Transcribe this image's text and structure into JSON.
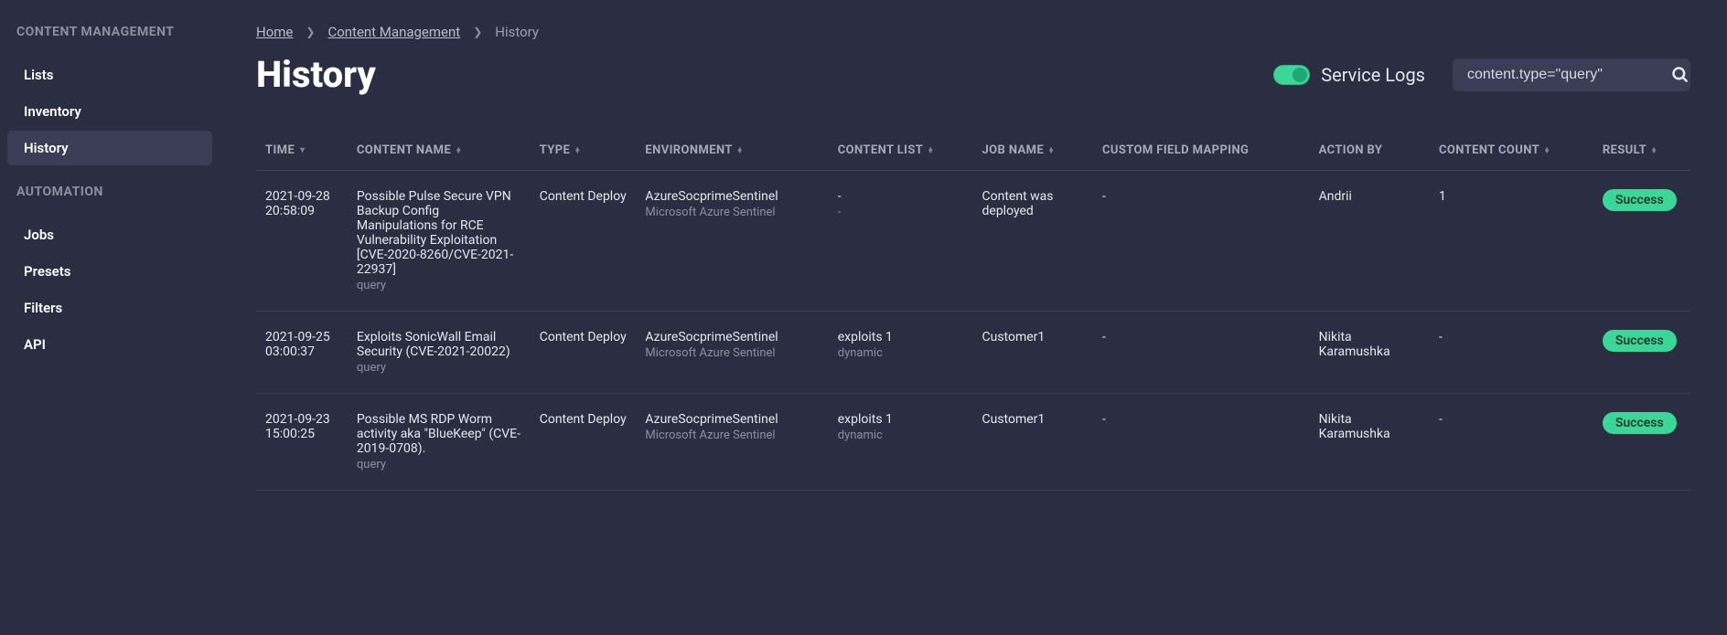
{
  "sidebar": {
    "section1_title": "CONTENT MANAGEMENT",
    "items1": [
      {
        "label": "Lists",
        "active": false
      },
      {
        "label": "Inventory",
        "active": false
      },
      {
        "label": "History",
        "active": true
      }
    ],
    "section2_title": "AUTOMATION",
    "items2": [
      {
        "label": "Jobs",
        "active": false
      },
      {
        "label": "Presets",
        "active": false
      },
      {
        "label": "Filters",
        "active": false
      },
      {
        "label": "API",
        "active": false
      }
    ]
  },
  "breadcrumb": {
    "items": [
      {
        "label": "Home",
        "link": true
      },
      {
        "label": "Content Management",
        "link": true
      },
      {
        "label": "History",
        "link": false
      }
    ]
  },
  "page": {
    "title": "History",
    "toggle_label": "Service Logs",
    "search_value": "content.type=\"query\""
  },
  "table": {
    "columns": [
      {
        "label": "TIME",
        "sort": "desc"
      },
      {
        "label": "CONTENT NAME",
        "sort": "both"
      },
      {
        "label": "TYPE",
        "sort": "both"
      },
      {
        "label": "ENVIRONMENT",
        "sort": "both"
      },
      {
        "label": "CONTENT LIST",
        "sort": "both"
      },
      {
        "label": "JOB NAME",
        "sort": "both"
      },
      {
        "label": "CUSTOM FIELD MAPPING",
        "sort": "none"
      },
      {
        "label": "ACTION BY",
        "sort": "none"
      },
      {
        "label": "CONTENT COUNT",
        "sort": "both"
      },
      {
        "label": "RESULT",
        "sort": "both"
      }
    ],
    "rows": [
      {
        "time_l1": "2021-09-28",
        "time_l2": "20:58:09",
        "name": "Possible Pulse Secure VPN Backup Config Manipulations for RCE Vulnerability Exploitation [CVE-2020-8260/CVE-2021-22937]",
        "name_sub": "query",
        "type": "Content Deploy",
        "env": "AzureSocprimeSentinel",
        "env_sub": "Microsoft Azure Sentinel",
        "list": "-",
        "list_sub": "-",
        "job": "Content was deployed",
        "custom": "-",
        "action_by": "Andrii",
        "count": "1",
        "result": "Success"
      },
      {
        "time_l1": "2021-09-25",
        "time_l2": "03:00:37",
        "name": "Exploits SonicWall Email Security (CVE-2021-20022)",
        "name_sub": "query",
        "type": "Content Deploy",
        "env": "AzureSocprimeSentinel",
        "env_sub": "Microsoft Azure Sentinel",
        "list": "exploits 1",
        "list_sub": "dynamic",
        "job": "Customer1",
        "custom": "-",
        "action_by": "Nikita Karamushka",
        "count": "-",
        "result": "Success"
      },
      {
        "time_l1": "2021-09-23",
        "time_l2": "15:00:25",
        "name": "Possible MS RDP Worm activity aka \"BlueKeep\" (CVE-2019-0708).",
        "name_sub": "query",
        "type": "Content Deploy",
        "env": "AzureSocprimeSentinel",
        "env_sub": "Microsoft Azure Sentinel",
        "list": "exploits 1",
        "list_sub": "dynamic",
        "job": "Customer1",
        "custom": "-",
        "action_by": "Nikita Karamushka",
        "count": "-",
        "result": "Success"
      }
    ]
  }
}
